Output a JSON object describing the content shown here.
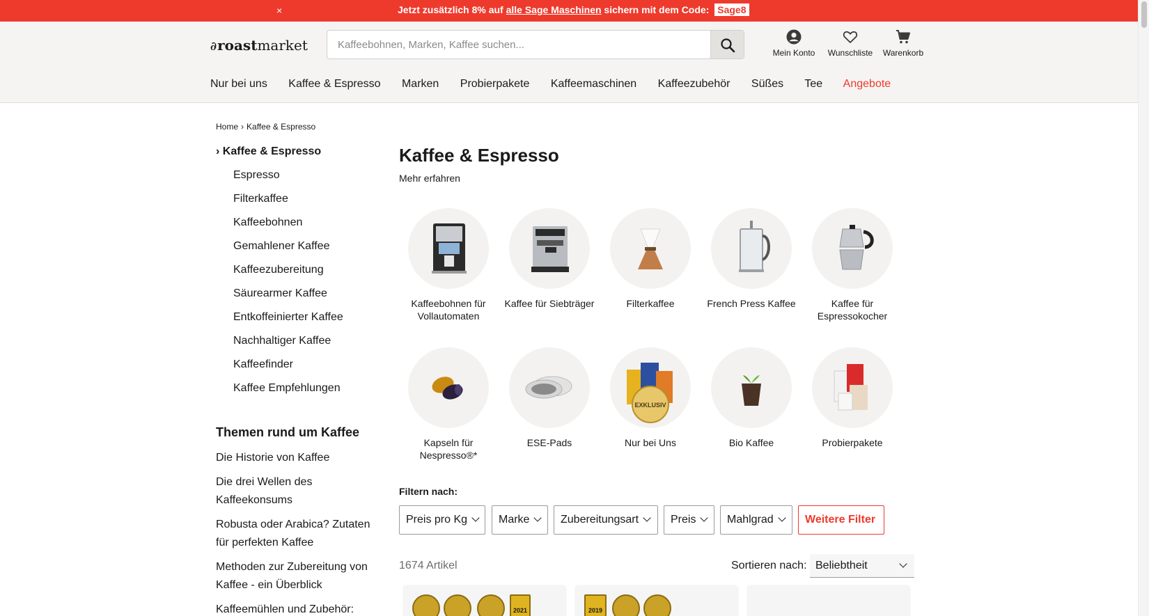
{
  "promo": {
    "close": "×",
    "text_before": "Jetzt zusätzlich 8% auf ",
    "link": "alle Sage Maschinen",
    "text_after": " sichern mit dem Code: ",
    "code": "Sage8"
  },
  "header": {
    "logo_bold": "roast",
    "logo_rest": "market",
    "search_placeholder": "Kaffeebohnen, Marken, Kaffee suchen...",
    "account": "Mein Konto",
    "wishlist": "Wunschliste",
    "cart": "Warenkorb"
  },
  "nav": [
    "Nur bei uns",
    "Kaffee & Espresso",
    "Marken",
    "Probierpakete",
    "Kaffeemaschinen",
    "Kaffeezubehör",
    "Süßes",
    "Tee",
    "Angebote"
  ],
  "breadcrumb": [
    "Home",
    "Kaffee & Espresso"
  ],
  "sidebar": {
    "active": "Kaffee & Espresso",
    "items": [
      "Espresso",
      "Filterkaffee",
      "Kaffeebohnen",
      "Gemahlener Kaffee",
      "Kaffeezubereitung",
      "Säurearmer Kaffee",
      "Entkoffeinierter Kaffee",
      "Nachhaltiger Kaffee",
      "Kaffeefinder",
      "Kaffee Empfehlungen"
    ],
    "themes_title": "Themen rund um Kaffee",
    "themes": [
      "Die Historie von Kaffee",
      "Die drei Wellen des Kaffeekonsums",
      "Robusta oder Arabica? Zutaten für perfekten Kaffee",
      "Methoden zur Zubereitung von Kaffee - ein Überblick",
      "Kaffeemühlen und Zubehör:"
    ]
  },
  "main": {
    "title": "Kaffee & Espresso",
    "more": "Mehr erfahren",
    "categories": [
      {
        "label": "Kaffeebohnen für Vollautomaten",
        "icon": "coffee-machine-icon"
      },
      {
        "label": "Kaffee für Siebträger",
        "icon": "espresso-machine-icon"
      },
      {
        "label": "Filterkaffee",
        "icon": "pour-over-icon"
      },
      {
        "label": "French Press Kaffee",
        "icon": "french-press-icon"
      },
      {
        "label": "Kaffee für Espressokocher",
        "icon": "moka-pot-icon"
      },
      {
        "label": "Kapseln für Nespresso®*",
        "icon": "capsules-icon"
      },
      {
        "label": "ESE-Pads",
        "icon": "pads-icon"
      },
      {
        "label": "Nur bei Uns",
        "icon": "exclusive-icon"
      },
      {
        "label": "Bio Kaffee",
        "icon": "plant-icon"
      },
      {
        "label": "Probierpakete",
        "icon": "sample-packs-icon"
      }
    ],
    "exclusive_badge": "EXKLUSIV",
    "filter_title": "Filtern nach:",
    "filters": [
      "Preis pro Kg",
      "Marke",
      "Zubereitungsart",
      "Preis",
      "Mahlgrad"
    ],
    "more_filters": "Weitere Filter",
    "count": "1674 Artikel",
    "sort_label": "Sortieren nach:",
    "sort_value": "Beliebtheit",
    "badge_years": [
      "2021",
      "2019"
    ]
  },
  "colors": {
    "accent": "#ee3a2c",
    "header_bg": "#f5f4f2",
    "circle_bg": "#f3f2f0"
  }
}
